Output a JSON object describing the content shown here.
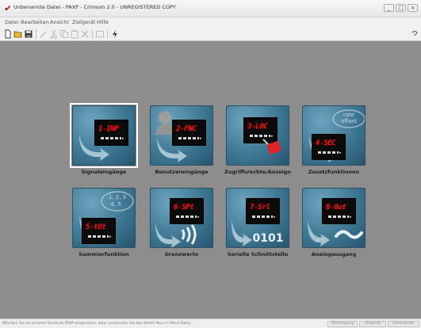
{
  "window": {
    "title": "Unbenannte Datei - PAXP - Crimson 2.0 - UNREGISTERED COPY",
    "buttons": [
      "minimize",
      "maximize",
      "close"
    ]
  },
  "menu": [
    "Datei",
    "Bearbeiten",
    "Ansicht",
    "Zielgerät",
    "Hilfe"
  ],
  "toolbar": {
    "tools": [
      "new-icon",
      "open-icon",
      "save-icon",
      "edit-icon",
      "cut-icon",
      "copy-icon",
      "paste-icon",
      "delete-icon",
      "window-icon",
      "lightning-icon"
    ]
  },
  "tiles": [
    {
      "label": "Signaleingänge",
      "lcd": "1-INP",
      "selected": true
    },
    {
      "label": "Benutzereingänge",
      "lcd": "2-FNC",
      "selected": false
    },
    {
      "label": "Zugriffsrechte/Anzeige",
      "lcd": "3-LOC",
      "selected": false
    },
    {
      "label": "Zusatzfunktionen",
      "lcd": "4-SEC",
      "overlay": "rate\noffset",
      "selected": false
    },
    {
      "label": "Summierfunktion",
      "lcd": "5-tOt",
      "overlay": "1, 2, 3\n4, 5",
      "selected": false
    },
    {
      "label": "Grenzwerte",
      "lcd": "6-SPt",
      "selected": false
    },
    {
      "label": "Serielle Schnittstelle",
      "lcd": "7-Srl",
      "overlay": "0101",
      "selected": false
    },
    {
      "label": "Analogausgang",
      "lcd": "8-Out",
      "selected": false
    }
  ],
  "status": {
    "text": "Möchten Sie ein anderes Gerät als PAXP ansprechen, dann verwenden Sie den Befehl Neu im Menü Datei.",
    "buttons": [
      "Übertragung",
      "Zielgerät",
      "Zeilenbreite"
    ]
  }
}
